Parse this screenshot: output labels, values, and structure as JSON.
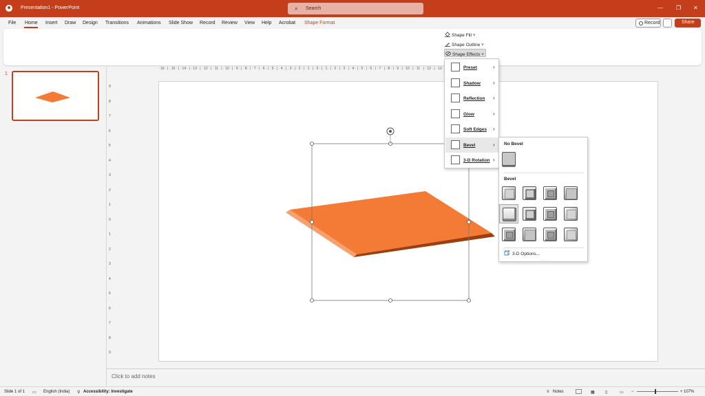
{
  "titlebar": {
    "title": "Presentation1  -  PowerPoint",
    "search_placeholder": "Search",
    "minimize": "—",
    "restore": "❐",
    "close": "✕"
  },
  "menu": {
    "file": "File",
    "home": "Home",
    "insert": "Insert",
    "draw": "Draw",
    "design": "Design",
    "transitions": "Transitions",
    "animations": "Animations",
    "slideshow": "Slide Show",
    "record": "Record",
    "review": "Review",
    "view": "View",
    "help": "Help",
    "acrobat": "Acrobat",
    "shape_format": "Shape Format",
    "record_button": "Record",
    "share_button": "Share"
  },
  "ribbon": {
    "shape_fill": "Shape Fill ˅",
    "shape_outline": "Shape Outline ˅",
    "shape_effects": "Shape Effects ˅"
  },
  "thumbnails": {
    "slide_number": "1"
  },
  "ruler": {
    "horizontal": "· 16 · | · 15 · | · 14 · | · 13 · | · 12 · | · 11 · | · 10 · | · 9 · | · 8 · | · 7 · | · 6 · | · 5 · | · 4 · | · 3 · | · 2 · | · 1 · | · 0 · | · 1 · | · 2 · | · 3 · | · 4 · | · 5 · | · 6 · | · 7 · | · 8 · | · 9 · | · 10 · | · 11 · | · 12 · | · 13 · | · 14 · | · 15 · | · 16 ·",
    "vertical": [
      "9",
      "8",
      "7",
      "6",
      "5",
      "4",
      "3",
      "2",
      "1",
      "0",
      "1",
      "2",
      "3",
      "4",
      "5",
      "6",
      "7",
      "8",
      "9"
    ]
  },
  "shape_effects_menu": {
    "items": [
      {
        "label": "Preset"
      },
      {
        "label": "Shadow"
      },
      {
        "label": "Reflection"
      },
      {
        "label": "Glow"
      },
      {
        "label": "Soft Edges"
      },
      {
        "label": "Bevel"
      },
      {
        "label": "3-D Rotation"
      }
    ],
    "chevron": "›"
  },
  "bevel_submenu": {
    "no_bevel_heading": "No Bevel",
    "bevel_heading": "Bevel",
    "options_label": "3-D Options...",
    "selected_index": 4
  },
  "notes": {
    "placeholder": "Click to add notes"
  },
  "status": {
    "slide_info": "Slide 1 of 1",
    "language": "English (India)",
    "accessibility": "Accessibility: Investigate",
    "notes_button": "Notes",
    "zoom_level": "107%",
    "zoom_minus": "−",
    "zoom_plus": "+"
  },
  "colors": {
    "accent": "#c43e1c",
    "shape_fill": "#f47b35",
    "shape_edge_light": "#f9a06f",
    "shape_edge_dark": "#9c3f0f"
  }
}
